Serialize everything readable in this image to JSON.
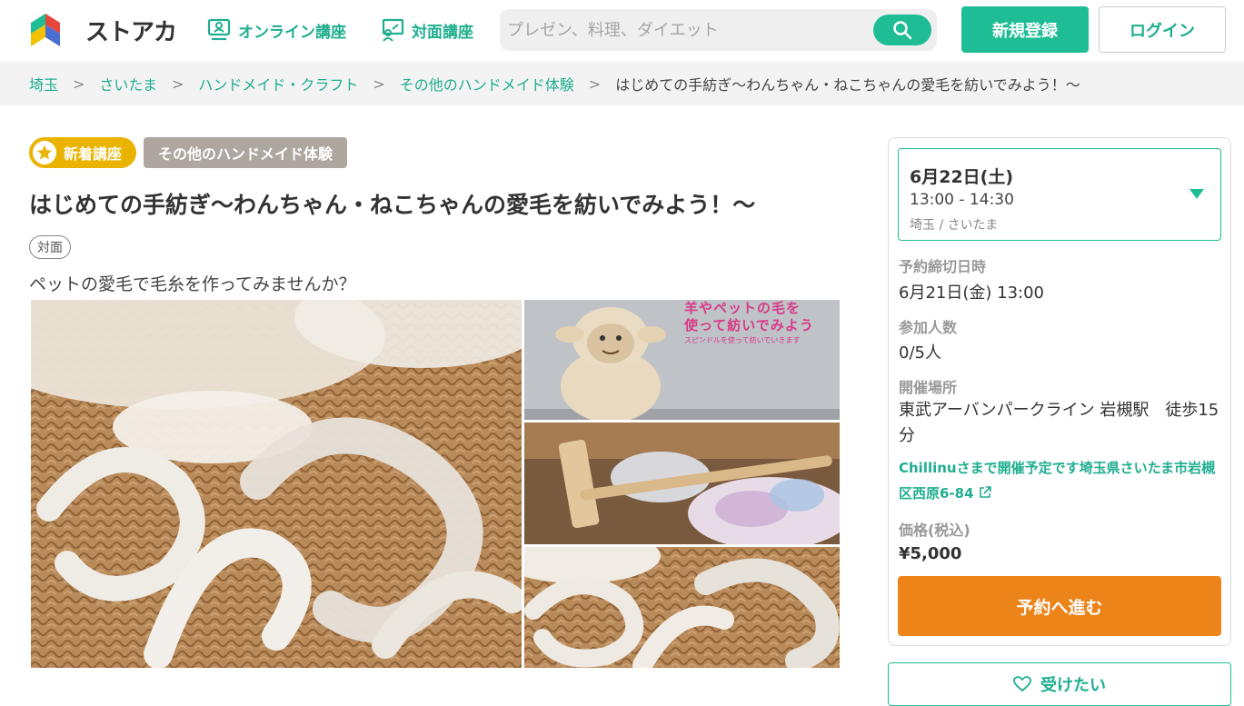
{
  "header": {
    "logo_text": "ストアカ",
    "nav_online": "オンライン講座",
    "nav_face": "対面講座",
    "search_placeholder": "プレゼン、料理、ダイエット",
    "register_label": "新規登録",
    "login_label": "ログイン"
  },
  "breadcrumb": {
    "items": [
      "埼玉",
      "さいたま",
      "ハンドメイド・クラフト",
      "その他のハンドメイド体験"
    ],
    "separator": ">",
    "current": "はじめての手紡ぎ〜わんちゃん・ねこちゃんの愛毛を紡いでみよう！〜"
  },
  "course": {
    "badge_new": "新着講座",
    "badge_category": "その他のハンドメイド体験",
    "title": "はじめての手紡ぎ〜わんちゃん・ねこちゃんの愛毛を紡いでみよう！〜",
    "format_tag": "対面",
    "subtitle": "ペットの愛毛で毛糸を作ってみませんか？",
    "photo_text_line1": "羊やペットの毛を",
    "photo_text_line2": "使って紡いでみよう",
    "photo_text_small": "スピンドルを使って紡いでいきます"
  },
  "sidebar": {
    "date": "6月22日(土)",
    "time": "13:00 - 14:30",
    "place": "埼玉 / さいたま",
    "deadline_label": "予約締切日時",
    "deadline_value": "6月21日(金) 13:00",
    "participants_label": "参加人数",
    "participants_value": "0/5人",
    "venue_label": "開催場所",
    "venue_value": "東武アーバンパークライン 岩槻駅　徒歩15分",
    "venue_note": "Chillinuさまで開催予定です埼玉県さいたま市岩槻区西原6-84",
    "price_label": "価格(税込)",
    "price_value": "¥5,000",
    "reserve_label": "予約へ進む",
    "want_label": "受けたい"
  },
  "colors": {
    "brand_green": "#1fbd95",
    "link_green": "#1fae8f",
    "reserve_orange": "#ec8419",
    "new_badge_yellow": "#e9b300"
  }
}
